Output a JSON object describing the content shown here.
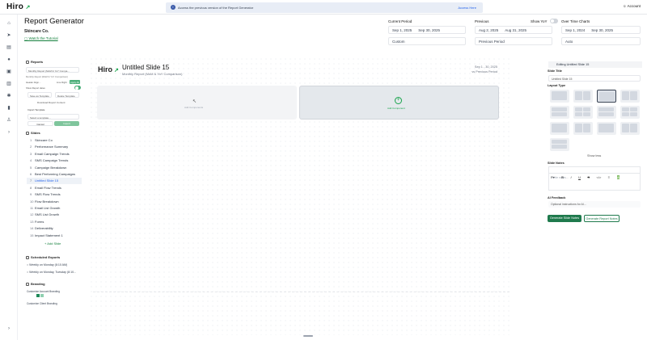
{
  "app": {
    "logo": "Hiro"
  },
  "banner": {
    "message": "Access the previous version of the Report Generator",
    "link": "Access Here"
  },
  "account": {
    "label": "Account"
  },
  "header": {
    "title": "Report Generator",
    "company": "Skincare Co.",
    "tutorial": "Watch the Tutorial",
    "current_period": {
      "label": "Current Period",
      "start": "Sep 1, 2025",
      "end": "Sep 30, 2025",
      "type": "Custom"
    },
    "previous": {
      "label": "Previous",
      "start": "Aug 2, 2025",
      "end": "Aug 31, 2025",
      "type": "Previous Period"
    },
    "show_yoy": {
      "label": "Show YoY"
    },
    "over_time": {
      "label": "Over Time Charts",
      "start": "Sep 1, 2024",
      "end": "Sep 30, 2025",
      "type": "Auto"
    }
  },
  "reports": {
    "title": "Reports",
    "selected": "Monthly Report (MoM & YoY Compa...",
    "meta": "Monthly Report (MoM & YoY Comparison)",
    "field1_label": "Header Align...",
    "field1_value": "Line Right",
    "field1_action": "Apply All",
    "auto_refresh_label": "Show Report dates",
    "save_template": "Save as Template",
    "delete": "Delete Template",
    "download": "Download Report Content",
    "import_label": "Import Template",
    "import_placeholder": "Select a template...",
    "cancel": "Cancel",
    "import": "Import"
  },
  "slides": {
    "title": "Slides",
    "items": [
      {
        "num": "1",
        "label": "Skincare Co"
      },
      {
        "num": "2",
        "label": "Performance Summary"
      },
      {
        "num": "3",
        "label": "Email Campaign Trends"
      },
      {
        "num": "4",
        "label": "SMS Campaign Trends"
      },
      {
        "num": "5",
        "label": "Campaign Breakdown"
      },
      {
        "num": "6",
        "label": "Best Performing Campaigns"
      },
      {
        "num": "7",
        "label": "Untitled Slide 15"
      },
      {
        "num": "8",
        "label": "Email Flow Trends"
      },
      {
        "num": "9",
        "label": "SMS Flow Trends"
      },
      {
        "num": "10",
        "label": "Flow Breakdown"
      },
      {
        "num": "11",
        "label": "Email List Growth"
      },
      {
        "num": "12",
        "label": "SMS List Growth"
      },
      {
        "num": "13",
        "label": "Forms"
      },
      {
        "num": "14",
        "label": "Deliverability"
      },
      {
        "num": "15",
        "label": "Impact Statement 1"
      }
    ],
    "add": "+ Add Slide"
  },
  "scheduled": {
    "title": "Scheduled Exports",
    "items": [
      "Weekly on Monday (8:10 AM)",
      "Weekly on Monday, Tuesday (8:10..."
    ]
  },
  "branding": {
    "title": "Branding",
    "items": [
      "Customize Account Branding",
      "Customize Client Branding"
    ],
    "colors": [
      "#1f8a5a",
      "#8fd0b0"
    ]
  },
  "slide": {
    "logo": "Hiro",
    "title": "Untitled Slide 15",
    "subtitle": "Monthly Report (MoM & YoY Comparison)",
    "dates": "Sep 1 - 30, 2025",
    "vs": "vs Previous Period",
    "block_left": "Add Components",
    "block_right": "Add Component"
  },
  "editor": {
    "header": "Editing Untitled Slide 15",
    "slide_title_label": "Slide Title",
    "slide_title_value": "Untitled Slide 15",
    "layout_label": "Layout Type",
    "show_less": "Show less",
    "notes_label": "Slide Notes",
    "notes_placeholder": "Write notes...",
    "toolbar": [
      "P▾",
      "B",
      "I",
      "U",
      "S",
      "</>",
      "≡",
      "A"
    ],
    "ai_label": "AI Feedback",
    "ai_placeholder": "Optional instructions for AI...",
    "generate": "Generate Slide Notes",
    "regenerate": "Generate Report Notes"
  },
  "colors": {
    "accent": "#15803d",
    "link": "#2563eb",
    "primary_btn": "#1f7a4d"
  }
}
